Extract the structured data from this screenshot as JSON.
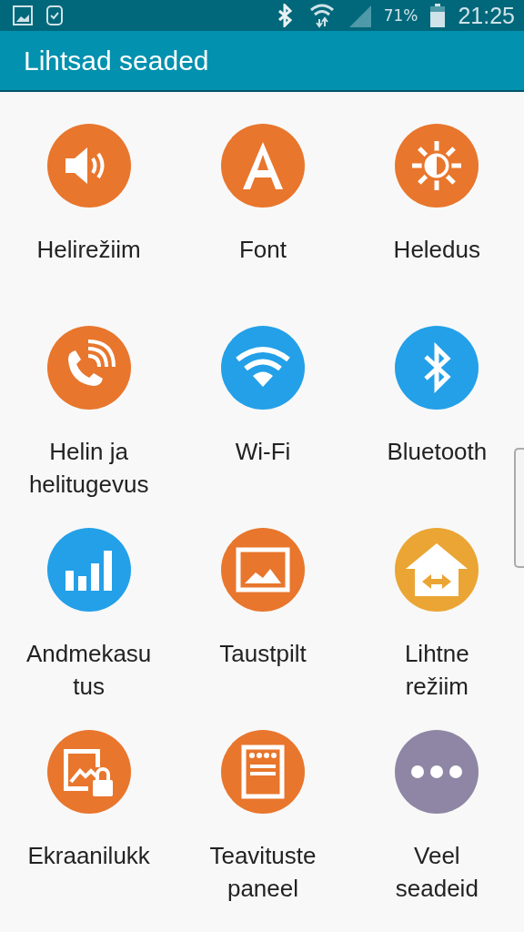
{
  "status_bar": {
    "battery_text": "71%",
    "time": "21:25"
  },
  "title": "Lihtsad seaded",
  "items": [
    {
      "lines": [
        "Helirežiim"
      ],
      "color": "#e8762d"
    },
    {
      "lines": [
        "Font"
      ],
      "color": "#e8762d"
    },
    {
      "lines": [
        "Heledus"
      ],
      "color": "#e8762d"
    },
    {
      "lines": [
        "Helin ja",
        "helitugevus"
      ],
      "color": "#e8762d"
    },
    {
      "lines": [
        "Wi-Fi"
      ],
      "color": "#23a0e8"
    },
    {
      "lines": [
        "Bluetooth"
      ],
      "color": "#23a0e8"
    },
    {
      "lines": [
        "Andmekasu",
        "tus"
      ],
      "color": "#23a0e8"
    },
    {
      "lines": [
        "Taustpilt"
      ],
      "color": "#e8762d"
    },
    {
      "lines": [
        "Lihtne",
        "režiim"
      ],
      "color": "#eaa534"
    },
    {
      "lines": [
        "Ekraanilukk"
      ],
      "color": "#e8762d"
    },
    {
      "lines": [
        "Teavituste",
        "paneel"
      ],
      "color": "#e8762d"
    },
    {
      "lines": [
        "Veel",
        "seadeid"
      ],
      "color": "#8e86a4"
    }
  ]
}
